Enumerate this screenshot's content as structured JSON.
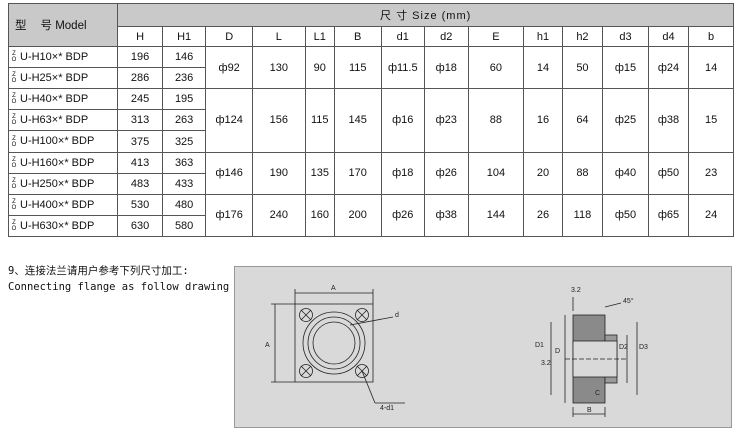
{
  "table": {
    "model_header_1": "型",
    "model_header_2": "号 Model",
    "size_header": "尺 寸  Size  (mm)",
    "columns": [
      "H",
      "H1",
      "D",
      "L",
      "L1",
      "B",
      "d1",
      "d2",
      "E",
      "h1",
      "h2",
      "d3",
      "d4",
      "b"
    ],
    "model_prefix": "Z O",
    "rows": [
      {
        "model": "U-H10×* BDP",
        "H": "196",
        "H1": "146"
      },
      {
        "model": "U-H25×* BDP",
        "H": "286",
        "H1": "236"
      },
      {
        "model": "U-H40×* BDP",
        "H": "245",
        "H1": "195"
      },
      {
        "model": "U-H63×* BDP",
        "H": "313",
        "H1": "263"
      },
      {
        "model": "U-H100×* BDP",
        "H": "375",
        "H1": "325"
      },
      {
        "model": "U-H160×* BDP",
        "H": "413",
        "H1": "363"
      },
      {
        "model": "U-H250×* BDP",
        "H": "483",
        "H1": "433"
      },
      {
        "model": "U-H400×* BDP",
        "H": "530",
        "H1": "480"
      },
      {
        "model": "U-H630×* BDP",
        "H": "630",
        "H1": "580"
      }
    ],
    "groups": [
      {
        "D": "ф92",
        "L": "130",
        "L1": "90",
        "B": "115",
        "d1": "ф11.5",
        "d2": "ф18",
        "E": "60",
        "h1": "14",
        "h2": "50",
        "d3": "ф15",
        "d4": "ф24",
        "b": "14"
      },
      {
        "D": "ф124",
        "L": "156",
        "L1": "115",
        "B": "145",
        "d1": "ф16",
        "d2": "ф23",
        "E": "88",
        "h1": "16",
        "h2": "64",
        "d3": "ф25",
        "d4": "ф38",
        "b": "15"
      },
      {
        "D": "ф146",
        "L": "190",
        "L1": "135",
        "B": "170",
        "d1": "ф18",
        "d2": "ф26",
        "E": "104",
        "h1": "20",
        "h2": "88",
        "d3": "ф40",
        "d4": "ф50",
        "b": "23"
      },
      {
        "D": "ф176",
        "L": "240",
        "L1": "160",
        "B": "200",
        "d1": "ф26",
        "d2": "ф38",
        "E": "144",
        "h1": "26",
        "h2": "118",
        "d3": "ф50",
        "d4": "ф65",
        "b": "24"
      }
    ]
  },
  "caption": {
    "line1": "9、连接法兰请用户参考下列尺寸加工:",
    "line2": "Connecting flange as follow drawing"
  },
  "drawing": {
    "front_labels": {
      "A_top": "A",
      "A_side": "A",
      "d": "d",
      "holes": "4-d1"
    },
    "side_labels": {
      "chamfer_top": "3.2",
      "angle": "45°",
      "D1": "D1",
      "D": "D",
      "D2": "D2",
      "D3": "D3",
      "chamfer_bottom": "3.2",
      "C": "C",
      "B": "B"
    }
  }
}
